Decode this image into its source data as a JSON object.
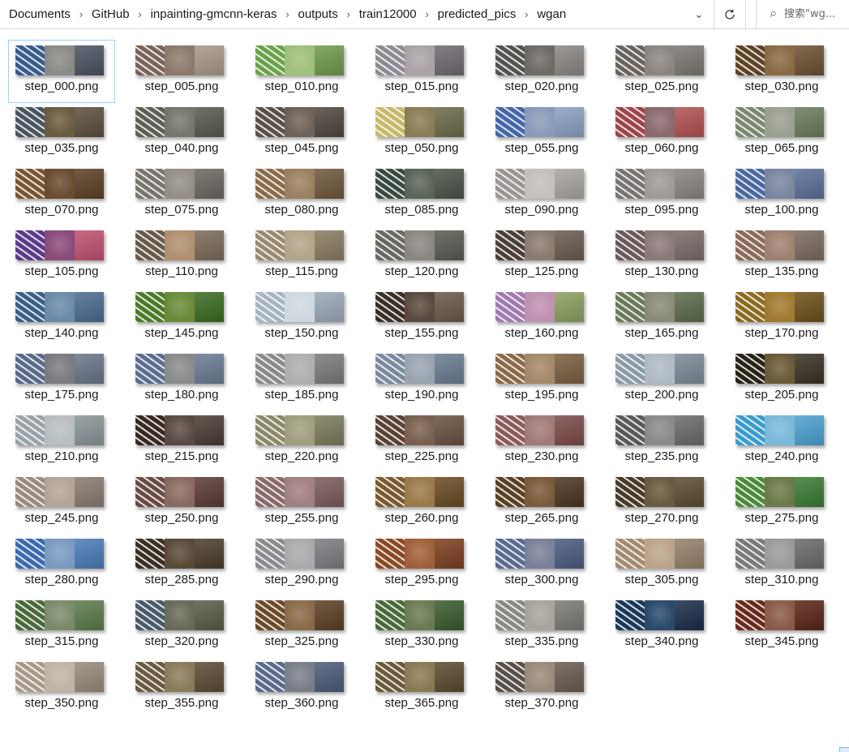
{
  "address": {
    "breadcrumbs": [
      "Documents",
      "GitHub",
      "inpainting-gmcnn-keras",
      "outputs",
      "train12000",
      "predicted_pics",
      "wgan"
    ],
    "separator_icon": "chevron-right-icon",
    "history_icon": "chevron-down-icon",
    "refresh_icon": "refresh-icon"
  },
  "search": {
    "placeholder": "搜索\"wg...",
    "icon": "search-icon"
  },
  "files": [
    {
      "name": "step_000.png",
      "selected": true,
      "colors": [
        "#3a5b8c",
        "#8a8a86",
        "#4a5262"
      ]
    },
    {
      "name": "step_005.png",
      "colors": [
        "#7a6358",
        "#8c7a6c",
        "#a89688"
      ]
    },
    {
      "name": "step_010.png",
      "colors": [
        "#6aa34a",
        "#9fbf7a",
        "#6f9a4c"
      ]
    },
    {
      "name": "step_015.png",
      "colors": [
        "#8f8a93",
        "#a9a3a8",
        "#6d6870"
      ]
    },
    {
      "name": "step_020.png",
      "colors": [
        "#55524f",
        "#6d6a66",
        "#8a8682"
      ]
    },
    {
      "name": "step_025.png",
      "colors": [
        "#6a6460",
        "#8a8580",
        "#7a7570"
      ]
    },
    {
      "name": "step_030.png",
      "colors": [
        "#5e4326",
        "#8a6a45",
        "#6b5030"
      ]
    },
    {
      "name": "step_035.png",
      "colors": [
        "#4b5560",
        "#6b5c40",
        "#5a4e3c"
      ]
    },
    {
      "name": "step_040.png",
      "colors": [
        "#5c6055",
        "#74786c",
        "#55594e"
      ]
    },
    {
      "name": "step_045.png",
      "colors": [
        "#5a5048",
        "#6e6258",
        "#4e463e"
      ]
    },
    {
      "name": "step_050.png",
      "colors": [
        "#c8b86a",
        "#8a7c55",
        "#6b6a4a"
      ]
    },
    {
      "name": "step_055.png",
      "colors": [
        "#4466aa",
        "#8a9ab8",
        "#8aa0c0"
      ]
    },
    {
      "name": "step_060.png",
      "colors": [
        "#a04448",
        "#8a6a6e",
        "#b05050"
      ]
    },
    {
      "name": "step_065.png",
      "colors": [
        "#7a8870",
        "#9aa090",
        "#6a7a5a"
      ]
    },
    {
      "name": "step_070.png",
      "colors": [
        "#7a5532",
        "#6a4c30",
        "#5a3e24"
      ]
    },
    {
      "name": "step_075.png",
      "colors": [
        "#7a756e",
        "#948e86",
        "#6a665e"
      ]
    },
    {
      "name": "step_080.png",
      "colors": [
        "#8a6c4c",
        "#9a8060",
        "#6e563c"
      ]
    },
    {
      "name": "step_085.png",
      "colors": [
        "#3a4a40",
        "#5a6458",
        "#4a5448"
      ]
    },
    {
      "name": "step_090.png",
      "colors": [
        "#9a9694",
        "#c4c0bc",
        "#a8a4a0"
      ]
    },
    {
      "name": "step_095.png",
      "colors": [
        "#7a7472",
        "#a09a96",
        "#8a8480"
      ]
    },
    {
      "name": "step_100.png",
      "colors": [
        "#4a68a0",
        "#7a86a0",
        "#5a6e98"
      ]
    },
    {
      "name": "step_105.png",
      "colors": [
        "#5a3a8a",
        "#8a4a7a",
        "#c05070"
      ]
    },
    {
      "name": "step_110.png",
      "colors": [
        "#6a5a4a",
        "#b09070",
        "#7a6a58"
      ]
    },
    {
      "name": "step_115.png",
      "colors": [
        "#9a8a70",
        "#b4a488",
        "#8a7a60"
      ]
    },
    {
      "name": "step_120.png",
      "colors": [
        "#6a6862",
        "#8a8680",
        "#5a5852"
      ]
    },
    {
      "name": "step_125.png",
      "colors": [
        "#4a4038",
        "#8a7a70",
        "#6a5a50"
      ]
    },
    {
      "name": "step_130.png",
      "colors": [
        "#6a5a5a",
        "#8a7a78",
        "#7a6a68"
      ]
    },
    {
      "name": "step_135.png",
      "colors": [
        "#8a6a5a",
        "#a08070",
        "#7a6a5e"
      ]
    },
    {
      "name": "step_140.png",
      "colors": [
        "#3a5e88",
        "#6a8aa8",
        "#4a6a90"
      ]
    },
    {
      "name": "step_145.png",
      "colors": [
        "#4a7a2a",
        "#6a8a3a",
        "#3a6a22"
      ]
    },
    {
      "name": "step_150.png",
      "colors": [
        "#a8b4c4",
        "#d0d8e0",
        "#9aa8b8"
      ]
    },
    {
      "name": "step_155.png",
      "colors": [
        "#3a3028",
        "#5a4a3e",
        "#6a5648"
      ]
    },
    {
      "name": "step_160.png",
      "colors": [
        "#a07ab0",
        "#c090b0",
        "#8aa060"
      ]
    },
    {
      "name": "step_165.png",
      "colors": [
        "#6a7a5a",
        "#8a8a78",
        "#5a6a4a"
      ]
    },
    {
      "name": "step_170.png",
      "colors": [
        "#8a6a20",
        "#a07a30",
        "#6a5018"
      ]
    },
    {
      "name": "step_175.png",
      "colors": [
        "#5a6a8a",
        "#7a7a80",
        "#6a7488"
      ]
    },
    {
      "name": "step_180.png",
      "colors": [
        "#5a6e90",
        "#8a8a8a",
        "#6a7a94"
      ]
    },
    {
      "name": "step_185.png",
      "colors": [
        "#8a8a8c",
        "#aeaeb0",
        "#7a7a7e"
      ]
    },
    {
      "name": "step_190.png",
      "colors": [
        "#7a8aa0",
        "#9aa4b0",
        "#6a7a90"
      ]
    },
    {
      "name": "step_195.png",
      "colors": [
        "#8a6a4a",
        "#a4886a",
        "#7a5e40"
      ]
    },
    {
      "name": "step_200.png",
      "colors": [
        "#8a9aa8",
        "#b0bac4",
        "#7a8a98"
      ]
    },
    {
      "name": "step_205.png",
      "colors": [
        "#2a2418",
        "#6a5a38",
        "#3a3020"
      ]
    },
    {
      "name": "step_210.png",
      "colors": [
        "#9aa4a8",
        "#b8bec0",
        "#8a9498"
      ]
    },
    {
      "name": "step_215.png",
      "colors": [
        "#3a2a24",
        "#5a4a44",
        "#4a3a34"
      ]
    },
    {
      "name": "step_220.png",
      "colors": [
        "#8a8a6a",
        "#a09e80",
        "#7a7a5c"
      ]
    },
    {
      "name": "step_225.png",
      "colors": [
        "#5a4234",
        "#7a6050",
        "#6a5040"
      ]
    },
    {
      "name": "step_230.png",
      "colors": [
        "#8a5a5a",
        "#a07a78",
        "#7a4a48"
      ]
    },
    {
      "name": "step_235.png",
      "colors": [
        "#5a5a5c",
        "#8a8a8a",
        "#6a6a6c"
      ]
    },
    {
      "name": "step_240.png",
      "colors": [
        "#3a9ad0",
        "#7ab8d8",
        "#4aa0d0"
      ]
    },
    {
      "name": "step_245.png",
      "colors": [
        "#9a8a80",
        "#b4a498",
        "#8a7a70"
      ]
    },
    {
      "name": "step_250.png",
      "colors": [
        "#6a4a44",
        "#8a6a60",
        "#5a3a34"
      ]
    },
    {
      "name": "step_255.png",
      "colors": [
        "#8a6a6a",
        "#a08080",
        "#7a5a5a"
      ]
    },
    {
      "name": "step_260.png",
      "colors": [
        "#7a5a30",
        "#9a7a48",
        "#6a4a24"
      ]
    },
    {
      "name": "step_265.png",
      "colors": [
        "#5a4024",
        "#7a5a3a",
        "#4a3420"
      ]
    },
    {
      "name": "step_270.png",
      "colors": [
        "#4a3a28",
        "#6a5a40",
        "#5a4a30"
      ]
    },
    {
      "name": "step_275.png",
      "colors": [
        "#4a8a3a",
        "#6a7a48",
        "#3a7a34"
      ]
    },
    {
      "name": "step_280.png",
      "colors": [
        "#3a6ab0",
        "#7a9ac0",
        "#4a7ab8"
      ]
    },
    {
      "name": "step_285.png",
      "colors": [
        "#3a3024",
        "#5a4a38",
        "#4a3c2c"
      ]
    },
    {
      "name": "step_290.png",
      "colors": [
        "#8a8c90",
        "#a8aaac",
        "#7a7c80"
      ]
    },
    {
      "name": "step_295.png",
      "colors": [
        "#8a4a24",
        "#a0603a",
        "#7a3e1e"
      ]
    },
    {
      "name": "step_300.png",
      "colors": [
        "#5a6a90",
        "#7a8098",
        "#4a5a80"
      ]
    },
    {
      "name": "step_305.png",
      "colors": [
        "#a48a70",
        "#bca48a",
        "#94806a"
      ]
    },
    {
      "name": "step_310.png",
      "colors": [
        "#7a7a7a",
        "#9a9a9a",
        "#6a6a6a"
      ]
    },
    {
      "name": "step_315.png",
      "colors": [
        "#4a6a3a",
        "#7a8a6a",
        "#5a7a4a"
      ]
    },
    {
      "name": "step_320.png",
      "colors": [
        "#4a5a6a",
        "#6a6a5a",
        "#5a5a48"
      ]
    },
    {
      "name": "step_325.png",
      "colors": [
        "#6a4a28",
        "#8a6a48",
        "#5a4024"
      ]
    },
    {
      "name": "step_330.png",
      "colors": [
        "#4a6a3a",
        "#6a7a54",
        "#3a5a2e"
      ]
    },
    {
      "name": "step_335.png",
      "colors": [
        "#8a8a84",
        "#a8a49c",
        "#7a7a74"
      ]
    },
    {
      "name": "step_340.png",
      "colors": [
        "#1a3a5a",
        "#2a4a6a",
        "#1a2a48"
      ]
    },
    {
      "name": "step_345.png",
      "colors": [
        "#6a2a1a",
        "#8a5a48",
        "#5a2418"
      ]
    },
    {
      "name": "step_350.png",
      "colors": [
        "#a89a8a",
        "#c0b4a4",
        "#988a7a"
      ]
    },
    {
      "name": "step_355.png",
      "colors": [
        "#6a5a40",
        "#8a7a5a",
        "#5a4a34"
      ]
    },
    {
      "name": "step_360.png",
      "colors": [
        "#5a6a8a",
        "#7a7e88",
        "#4a5a78"
      ]
    },
    {
      "name": "step_365.png",
      "colors": [
        "#6a5a38",
        "#8a7a54",
        "#5a4a2e"
      ]
    },
    {
      "name": "step_370.png",
      "colors": [
        "#5a504a",
        "#9a8a7a",
        "#6a5a50"
      ]
    }
  ]
}
